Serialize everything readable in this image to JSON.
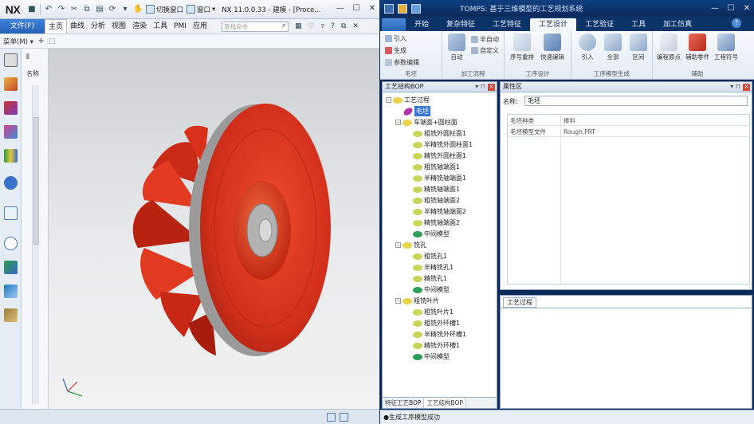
{
  "nx": {
    "logo": "NX",
    "window_title": "NX 11.0.0.33 - 建模 - [Proce...",
    "quick_access": {
      "switch_window_label": "切换窗口",
      "window_label": "窗口",
      "window_arrow": "▾",
      "menu_arrow": "▾"
    },
    "menu": {
      "file": "文件(F)",
      "items": [
        "主页",
        "曲线",
        "分析",
        "视图",
        "渲染",
        "工具",
        "PMI",
        "应用"
      ],
      "search_placeholder": "查找命令"
    },
    "toolbar2": {
      "menu_label": "菜单(M)",
      "menu_arrow": "▾"
    },
    "nav": {
      "name_label": "名称"
    },
    "colors": {
      "impeller_red": "#d7301f",
      "hub_grey": "#a8a8a8",
      "disc_edge": "#8e1b10"
    }
  },
  "tomps": {
    "window_title": "TOMPS: 基于三维模型的工艺规划系统",
    "tabs": [
      "开始",
      "复杂特征",
      "工艺特征",
      "工艺设计",
      "工艺验证",
      "工具",
      "加工仿真"
    ],
    "active_tab": "工艺设计",
    "ribbon": {
      "groups": {
        "blank": {
          "name": "毛坯",
          "buttons": [
            "引入",
            "生成",
            "参数编辑"
          ]
        },
        "process_proc": {
          "name": "加工流程",
          "big": "自动",
          "small": [
            "半自动",
            "自定义"
          ]
        },
        "process_design": {
          "name": "工序设计",
          "buttons": [
            "序号重排",
            "快速编辑"
          ]
        },
        "model_gen": {
          "name": "工序模型生成",
          "buttons": [
            "引入",
            "全部",
            "区间"
          ]
        },
        "aux": {
          "name": "辅助",
          "buttons": [
            "编程原点",
            "辅助零件",
            "工程符号"
          ]
        }
      }
    },
    "tree_panel": {
      "title": "工艺结构BOP",
      "pin": "▾ ⊓",
      "root": "工艺过程",
      "blank": "毛坯",
      "groups": [
        {
          "label": "车端面+圆柱面",
          "children": [
            "粗铣外圆柱面1",
            "半精铣外圆柱面1",
            "精铣外圆柱面1",
            "粗铣轴端面1",
            "半精铣轴端面1",
            "精铣轴端面1",
            "粗铣轴端面2",
            "半精铣轴端面2",
            "精铣轴端面2",
            "中间模型"
          ]
        },
        {
          "label": "铣孔",
          "children": [
            "粗铣孔1",
            "半精铣孔1",
            "精铣孔1",
            "中间模型"
          ]
        },
        {
          "label": "粗铣叶片",
          "children": [
            "粗铣叶片1",
            "粗铣外环槽1",
            "半精铣外环槽1",
            "精铣外环槽1",
            "中间模型"
          ]
        }
      ],
      "bottom_tabs": [
        "特征工艺BOP",
        "工艺结构BOP"
      ],
      "active_bottom_tab": "工艺结构BOP"
    },
    "props_panel": {
      "title": "属性区",
      "name_label": "名称:",
      "name_value": "毛坯",
      "rows": [
        {
          "key": "毛坯种类",
          "value": "棒料"
        },
        {
          "key": "毛坯模型文件",
          "value": "Rough.PRT"
        }
      ]
    },
    "proc_panel": {
      "tab": "工艺过程"
    },
    "status": "●生成工序模型成功"
  }
}
